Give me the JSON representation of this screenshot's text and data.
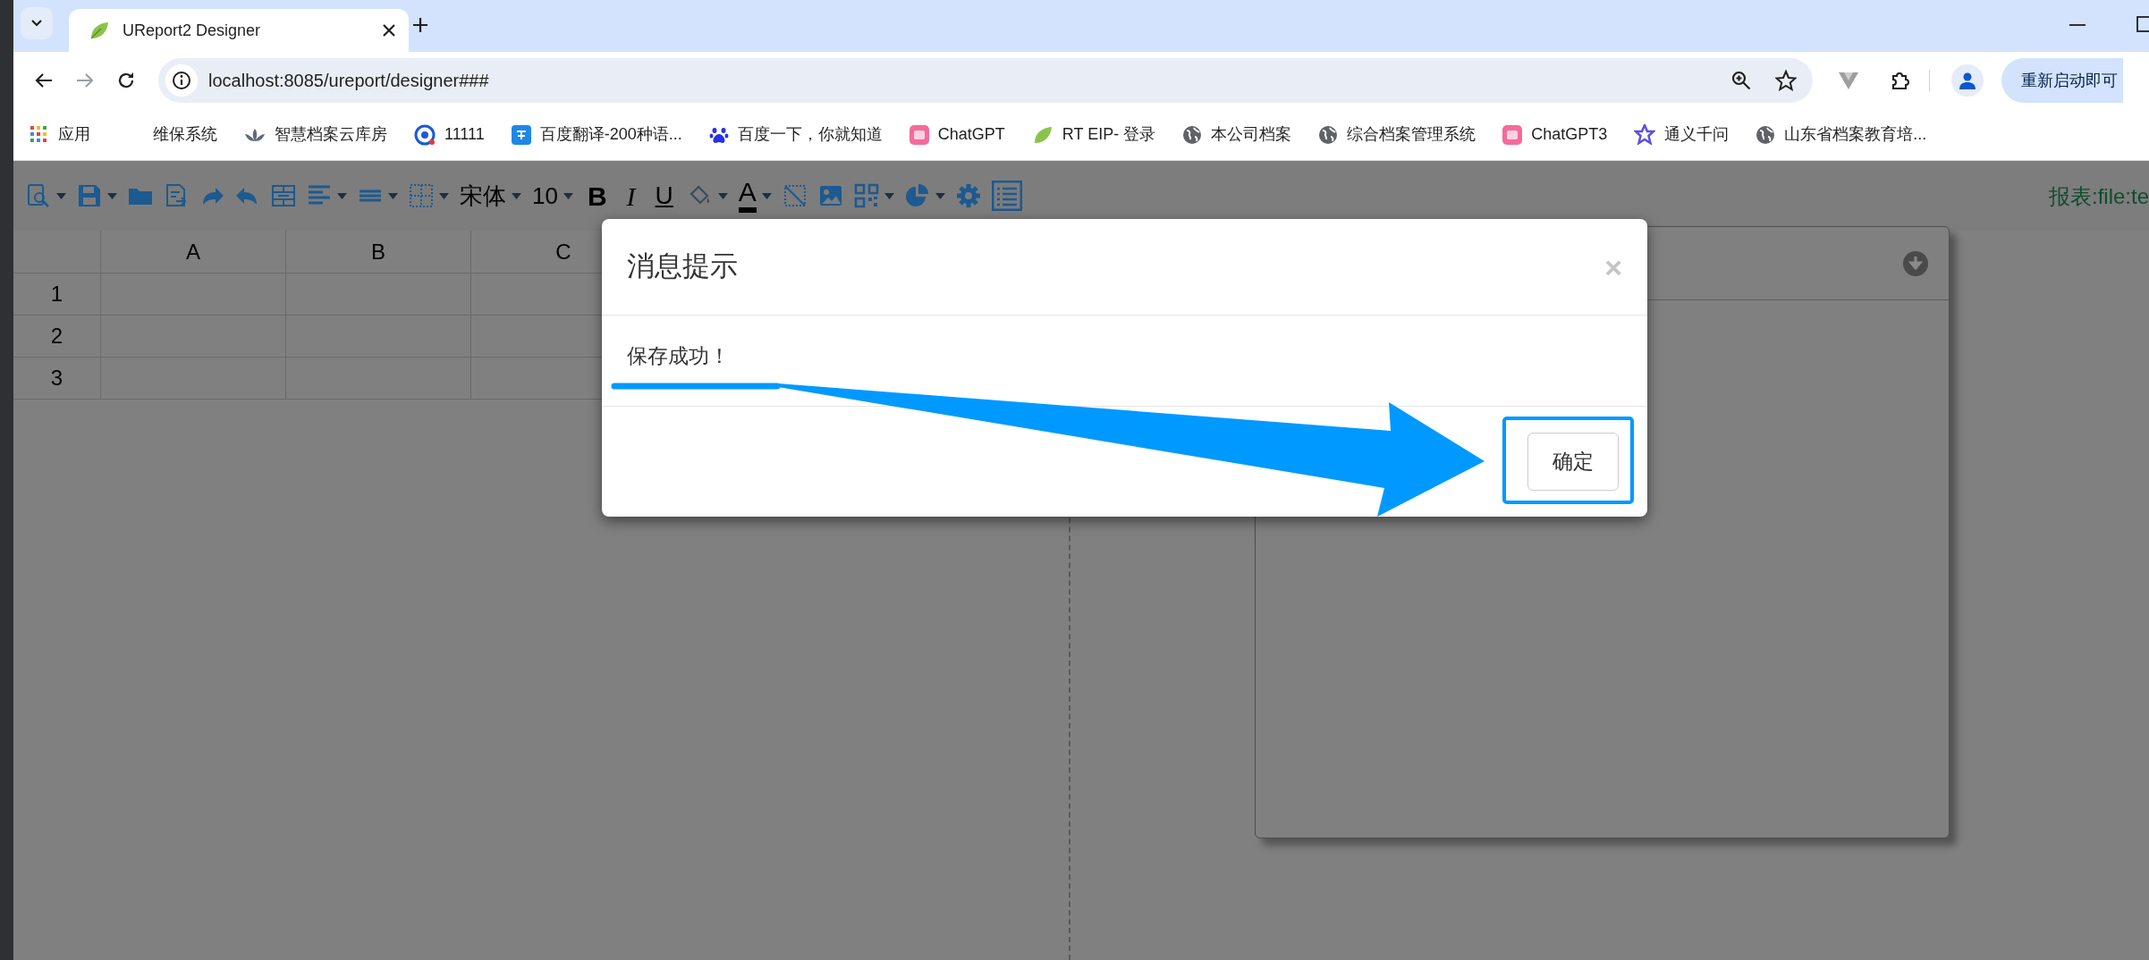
{
  "browser": {
    "tab": {
      "title": "UReport2 Designer",
      "selected": true
    },
    "url": "localhost:8085/ureport/designer###",
    "update_button": "重新启动即可",
    "bookmarks": [
      {
        "label": "应用"
      },
      {
        "label": "维保系统"
      },
      {
        "label": "智慧档案云库房"
      },
      {
        "label": "11111"
      },
      {
        "label": "百度翻译-200种语..."
      },
      {
        "label": "百度一下，你就知道"
      },
      {
        "label": "ChatGPT"
      },
      {
        "label": "RT EIP- 登录"
      },
      {
        "label": "本公司档案"
      },
      {
        "label": "综合档案管理系统"
      },
      {
        "label": "ChatGPT3"
      },
      {
        "label": "通义千问"
      },
      {
        "label": "山东省档案教育培..."
      }
    ]
  },
  "toolbar": {
    "font_family": "宋体",
    "font_size": "10",
    "bold": "B",
    "italic": "I",
    "underline": "U",
    "font_color": "A"
  },
  "report_label": "报表:file:te",
  "grid": {
    "columns": [
      "A",
      "B",
      "C"
    ],
    "rows": [
      "1",
      "2",
      "3"
    ]
  },
  "dialog": {
    "title": "消息提示",
    "close": "×",
    "message": "保存成功！",
    "ok_button": "确定"
  }
}
